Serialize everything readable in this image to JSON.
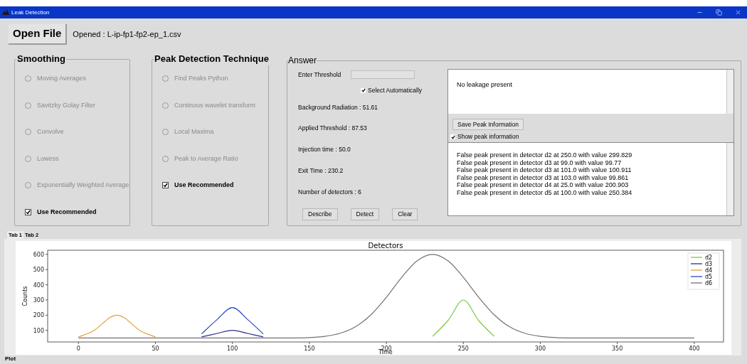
{
  "window": {
    "title": "Leak Detection"
  },
  "file": {
    "button": "Open File",
    "status": "Opened : L-ip-fp1-fp2-ep_1.csv"
  },
  "smoothing": {
    "title": "Smoothing",
    "options": [
      {
        "kind": "radio",
        "label": "Moving Averages",
        "selected": false,
        "disabled": true
      },
      {
        "kind": "radio",
        "label": "Savitzky Golay Filter",
        "selected": false,
        "disabled": true
      },
      {
        "kind": "radio",
        "label": "Convolve",
        "selected": false,
        "disabled": true
      },
      {
        "kind": "radio",
        "label": "Lowess",
        "selected": false,
        "disabled": true
      },
      {
        "kind": "radio",
        "label": "Exponentially Weighted Average",
        "selected": false,
        "disabled": true
      },
      {
        "kind": "checkbox",
        "label": "Use Recommended",
        "checked": true
      }
    ]
  },
  "peak_detection": {
    "title": "Peak Detection Technique",
    "options": [
      {
        "kind": "radio",
        "label": "Find Peaks Python",
        "selected": false,
        "disabled": true
      },
      {
        "kind": "radio",
        "label": "Continous wavelet transform",
        "selected": false,
        "disabled": true
      },
      {
        "kind": "radio",
        "label": "Local Maxima",
        "selected": false,
        "disabled": true
      },
      {
        "kind": "radio",
        "label": "Peak to Average Ratio",
        "selected": false,
        "disabled": true
      },
      {
        "kind": "checkbox",
        "label": "Use Recommended",
        "checked": true
      }
    ]
  },
  "answer": {
    "title": "Answer",
    "threshold_label": "Enter Threshold",
    "select_automatically": {
      "label": "Select Automatically",
      "checked": true
    },
    "readouts": [
      "Background Radiation : 51.61",
      "Applied Threshold : 87.53",
      "Injection time : 50.0",
      "Exit Time : 230.2",
      "Number of detectors : 6"
    ],
    "buttons": [
      "Describe",
      "Detect",
      "Clear"
    ],
    "result": "No leakage present",
    "save_button": "Save Peak Information",
    "show_peaks": {
      "label": "Show peak information",
      "checked": true
    },
    "peaks": [
      "False peak present in detector d2 at 250.0 with value 299.829",
      "False peak present in detector d3 at 99.0 with value 99.77",
      "False peak present in detector d3 at 101.0 with value 100.911",
      "False peak present in detector d3 at 103.0 with value 99.861",
      "False peak present in detector d4 at 25.0 with value 200.903",
      "False peak present in detector d5 at 100.0 with value 250.384"
    ]
  },
  "tabs": [
    {
      "label": "Tab 1",
      "selected": true
    },
    {
      "label": "Tab 2",
      "selected": false
    }
  ],
  "plot": {
    "chart_data": {
      "type": "line",
      "title": "Detectors",
      "xlabel": "Time",
      "ylabel": "Counts",
      "x": [
        0,
        10,
        20,
        25,
        30,
        40,
        50,
        60,
        70,
        80,
        90,
        100,
        110,
        120,
        130,
        140,
        150,
        160,
        170,
        180,
        190,
        200,
        210,
        220,
        230,
        240,
        250,
        260,
        270,
        280,
        290,
        300,
        310,
        320,
        330,
        340,
        350,
        360,
        370,
        380,
        390,
        400
      ],
      "series": [
        {
          "name": "d2",
          "color": "#7cc84a",
          "values": [
            null,
            null,
            null,
            null,
            null,
            null,
            null,
            null,
            null,
            null,
            null,
            null,
            null,
            null,
            null,
            null,
            null,
            null,
            null,
            null,
            null,
            null,
            null,
            null,
            61,
            164,
            300,
            164,
            61,
            null,
            null,
            null,
            null,
            null,
            null,
            null,
            null,
            null,
            null,
            null,
            null,
            null
          ]
        },
        {
          "name": "d3",
          "color": "#2b2f8a",
          "values": [
            null,
            null,
            null,
            null,
            null,
            null,
            null,
            null,
            null,
            57,
            80,
            100,
            80,
            57,
            null,
            null,
            null,
            null,
            null,
            null,
            null,
            null,
            null,
            null,
            null,
            null,
            null,
            null,
            null,
            null,
            null,
            null,
            null,
            null,
            null,
            null,
            null,
            null,
            null,
            null,
            null,
            null
          ]
        },
        {
          "name": "d4",
          "color": "#e0a040",
          "values": [
            57,
            99,
            182,
            200,
            182,
            99,
            57,
            null,
            null,
            null,
            null,
            null,
            null,
            null,
            null,
            null,
            null,
            null,
            null,
            null,
            null,
            null,
            null,
            null,
            null,
            null,
            null,
            null,
            null,
            null,
            null,
            null,
            null,
            null,
            null,
            null,
            null,
            null,
            null,
            null,
            null,
            null
          ]
        },
        {
          "name": "d5",
          "color": "#2448c4",
          "values": [
            null,
            null,
            null,
            null,
            null,
            null,
            null,
            null,
            null,
            77,
            171,
            250,
            171,
            77,
            null,
            null,
            null,
            null,
            null,
            null,
            null,
            null,
            null,
            null,
            null,
            null,
            null,
            null,
            null,
            null,
            null,
            null,
            null,
            null,
            null,
            null,
            null,
            null,
            null,
            null,
            null,
            null
          ]
        },
        {
          "name": "d6",
          "color": "#7a6e76",
          "values": [
            50,
            50,
            50,
            50,
            50,
            50,
            50,
            50,
            50,
            50,
            50,
            50,
            50,
            50,
            50,
            50,
            53,
            61,
            81,
            124,
            203,
            318,
            449,
            558,
            600,
            558,
            449,
            318,
            203,
            124,
            81,
            61,
            53,
            50,
            50,
            50,
            50,
            50,
            50,
            50,
            50,
            50
          ]
        }
      ],
      "legend": "upper right",
      "xlim": [
        -20,
        419
      ],
      "ylim": [
        24,
        627
      ],
      "xticks": [
        0,
        50,
        100,
        150,
        200,
        250,
        300,
        350,
        400
      ],
      "yticks": [
        100,
        200,
        300,
        400,
        500,
        600
      ]
    },
    "caption": "Plot"
  }
}
